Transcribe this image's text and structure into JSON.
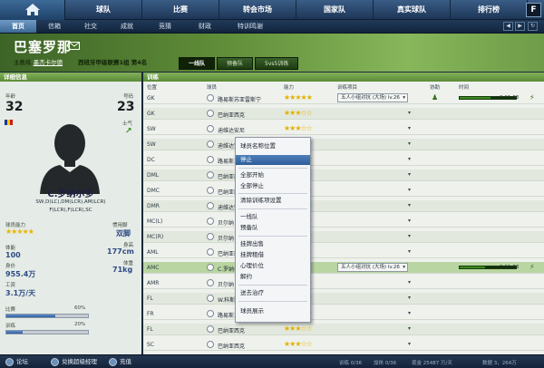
{
  "nav": {
    "items": [
      "球队",
      "比赛",
      "转会市场",
      "国家队",
      "真实球队",
      "排行榜"
    ],
    "logo": "F"
  },
  "subnav": {
    "items": [
      "首页",
      "信箱",
      "社交",
      "成就",
      "竞猜",
      "财政",
      "特训鸣谢"
    ]
  },
  "team": {
    "name": "巴塞罗那",
    "manager_label": "主教练",
    "manager": "墨杰卡尔德",
    "league": "西班牙甲级联赛1组 第4名"
  },
  "squad_tabs": [
    "一线队",
    "预备队",
    "5vs5训练"
  ],
  "detail": {
    "title": "详细信息",
    "age_label": "年龄",
    "age": "32",
    "number_label": "号码",
    "number": "23",
    "morale_label": "士气",
    "player_name": "C.罗纳尔多",
    "positions_line1": "SW,D(LC),DM(LCR),AM(LCR)",
    "positions_line2": "F(LCR),F(LCR),SC",
    "ability_label": "球员能力",
    "foot_label": "惯用脚",
    "foot": "双脚",
    "height_label": "身高",
    "height": "177cm",
    "weight_label": "体重",
    "weight": "71kg",
    "stamina_label": "体能",
    "stamina": "100",
    "value_label": "身价",
    "value": "955.4万",
    "wage_label": "工资",
    "wage": "3.1万/天",
    "match_label": "比赛",
    "match_pct": "60%",
    "match_fill": 0.6,
    "train_label": "训练",
    "train_pct": "20%",
    "train_fill": 0.2
  },
  "training": {
    "title": "训练",
    "columns": [
      "位置",
      "球员",
      "能力",
      "训练项目",
      "协助",
      "时间"
    ]
  },
  "rows": [
    {
      "pos": "GK",
      "name": "路易斯苏亚雷斯宁",
      "stars": "★★★★★",
      "training": "五人小组对抗 (大场) lv.26",
      "progress": 0.55,
      "time": "0:11:63"
    },
    {
      "pos": "GK",
      "name": "巴纳亚西克",
      "stars": "★★★☆☆"
    },
    {
      "pos": "SW",
      "name": "迪维达安尼",
      "stars": "★★★☆☆"
    },
    {
      "pos": "SW",
      "name": "迪维达安尼",
      "stars": "★★★☆☆"
    },
    {
      "pos": "DC",
      "name": "路易斯苏亚雷斯",
      "stars": "★★★★☆"
    },
    {
      "pos": "DML",
      "name": "巴纳亚西克",
      "stars": "★★★☆☆"
    },
    {
      "pos": "DMC",
      "name": "巴纳亚西克",
      "stars": "★★★☆☆"
    },
    {
      "pos": "DMR",
      "name": "迪维达安尼",
      "stars": "★★★☆☆"
    },
    {
      "pos": "MC(L)",
      "name": "贝尔纳",
      "stars": "★★★☆☆"
    },
    {
      "pos": "MC(R)",
      "name": "贝尔纳",
      "stars": "★★★☆☆"
    },
    {
      "pos": "AML",
      "name": "巴纳亚西克",
      "stars": "★★★☆☆"
    },
    {
      "pos": "AMC",
      "name": "C.罗纳尔多",
      "stars": "★★★★★",
      "training": "五人小组对抗 (大场) lv.26",
      "progress": 0.45,
      "time": "0:11:63"
    },
    {
      "pos": "AMR",
      "name": "贝尔纳",
      "stars": "★★★☆☆"
    },
    {
      "pos": "FL",
      "name": "W.科斯",
      "stars": "★★★☆☆"
    },
    {
      "pos": "FR",
      "name": "路易斯苏亚雷斯",
      "stars": "★★★☆☆"
    },
    {
      "pos": "FL",
      "name": "巴纳亚西克",
      "stars": "★★★☆☆"
    },
    {
      "pos": "SC",
      "name": "巴纳亚西克",
      "stars": "★★★☆☆"
    }
  ],
  "menu": [
    "球员名称位置",
    "停止",
    "全部开始",
    "全部停止",
    "清除训练项设置",
    "一线队",
    "预备队",
    "挂牌出售",
    "挂牌租借",
    "心理价位",
    "解约",
    "送去治疗",
    "球员展示"
  ],
  "footer": {
    "forum": "论坛",
    "redeem": "兑换超级经理",
    "recharge": "充值",
    "training_status": "训练 0/36",
    "save_status": "加休 0/36",
    "cash_status": "现金 25487 万/天",
    "data_status": "数据 3，264万"
  }
}
